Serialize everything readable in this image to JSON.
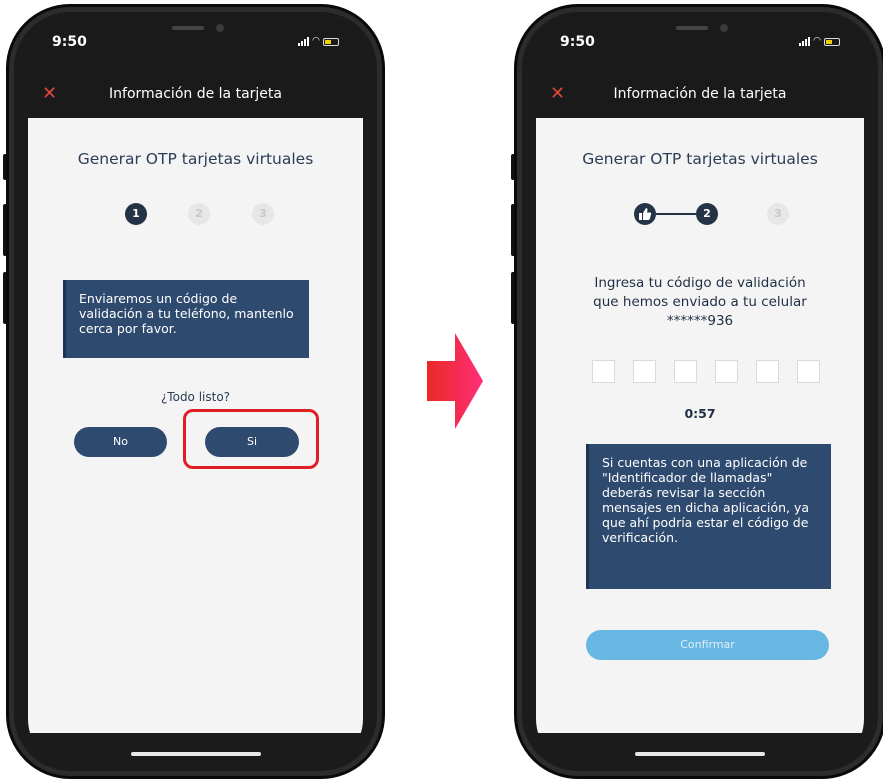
{
  "colors": {
    "accent": "#2f4a6f",
    "step_active": "#253346",
    "close": "#e0453b",
    "highlight": "#e01e25",
    "confirm": "#68b7e2",
    "arrow_start": "#e82a23",
    "arrow_end": "#ff2e7a"
  },
  "icons": {
    "close": "close-icon",
    "step_done": "thumbs-up-icon",
    "transition": "arrow-right-icon"
  },
  "left_screen": {
    "status_time": "9:50",
    "nav_title": "Información de la tarjeta",
    "page_title": "Generar OTP tarjetas virtuales",
    "steps": [
      "1",
      "2",
      "3"
    ],
    "info_text": "Enviaremos un código de validación a tu teléfono, mantenlo cerca por favor.",
    "question": "¿Todo listo?",
    "no_label": "No",
    "yes_label": "Si"
  },
  "right_screen": {
    "status_time": "9:50",
    "nav_title": "Información de la tarjeta",
    "page_title": "Generar OTP tarjetas virtuales",
    "steps": [
      "2",
      "3"
    ],
    "prompt": "Ingresa tu código de validación que hemos enviado a tu celular ******936",
    "otp_values": [
      "",
      "",
      "",
      "",
      "",
      ""
    ],
    "timer": "0:57",
    "info_text": "Si cuentas con una aplicación de \"Identificador de llamadas\" deberás revisar la sección mensajes en dicha aplicación, ya que ahí podría estar el código de verificación.",
    "confirm_label": "Confirmar"
  }
}
